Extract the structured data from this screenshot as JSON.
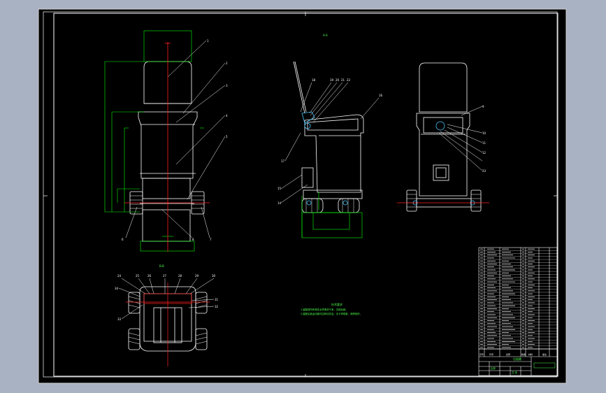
{
  "drawing": {
    "view_a_label": "A-A",
    "view_b_label": "B-B",
    "notes_heading": "技术要求",
    "notes": [
      "1.装配前所有零件必须清洗干净，去除毛刺。",
      "2.装配后各运动部件应转动灵活，无卡滞现象，润滑良好。"
    ],
    "part_callouts_front": [
      "1",
      "2",
      "3",
      "4",
      "5",
      "6",
      "7",
      "8"
    ],
    "part_callouts_side_top": [
      "18",
      "19",
      "20",
      "21",
      "22"
    ],
    "part_callouts_side": [
      "16",
      "17",
      "15",
      "14",
      "13"
    ],
    "part_callouts_right": [
      "9",
      "10",
      "11",
      "12",
      "23"
    ],
    "part_callouts_bottom": [
      "24",
      "25",
      "26",
      "27",
      "28",
      "29",
      "30",
      "31",
      "32",
      "33",
      "34"
    ],
    "title_block": {
      "drawing_name": "垃圾桶",
      "company": "",
      "scale_label": "比例",
      "sheet_label": "共 张"
    },
    "parts_table_header": [
      "序号",
      "代号",
      "名称",
      "数量",
      "材料",
      "备注"
    ],
    "parts_rows": 34
  },
  "colors": {
    "screen_bg": "#a9b2c3",
    "paper": "#000000",
    "line": "#ffffff",
    "construction": "#00ff00",
    "centerline": "#ff2020",
    "accent": "#4cff4c"
  }
}
